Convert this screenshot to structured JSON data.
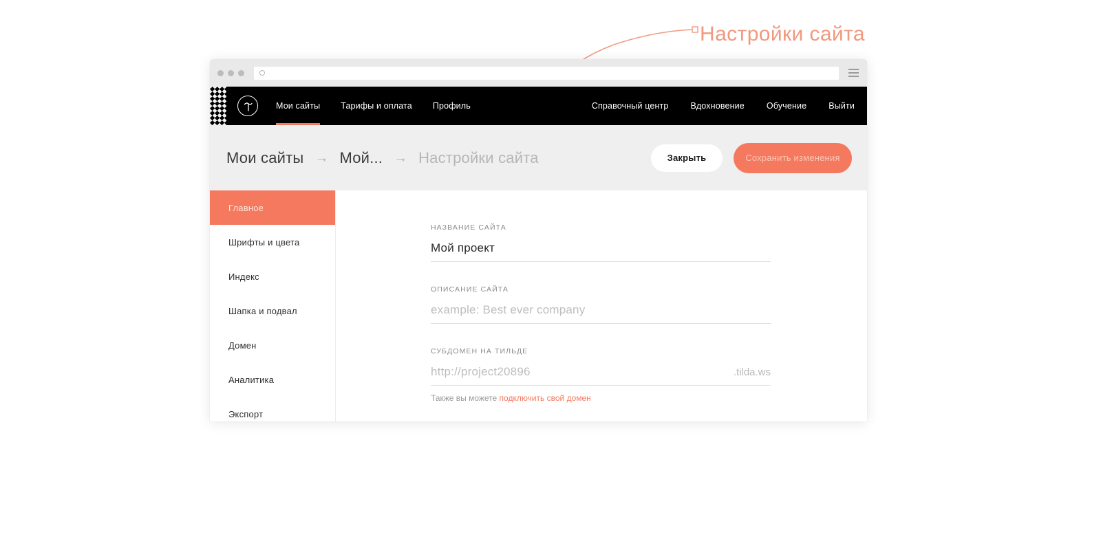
{
  "annotation": {
    "label": "Настройки сайта",
    "color": "#f0997f"
  },
  "browser": {
    "address_value": "",
    "address_placeholder": "",
    "menu_icon": "hamburger-icon"
  },
  "topnav": {
    "logo_icon": "tilda-logo-icon",
    "left_items": [
      {
        "label": "Мои сайты",
        "active": true
      },
      {
        "label": "Тарифы и оплата",
        "active": false
      },
      {
        "label": "Профиль",
        "active": false
      }
    ],
    "right_items": [
      {
        "label": "Справочный центр"
      },
      {
        "label": "Вдохновение"
      },
      {
        "label": "Обучение"
      },
      {
        "label": "Выйти"
      }
    ],
    "accent": "#f4795f"
  },
  "breadcrumb": {
    "items": [
      {
        "label": "Мои сайты",
        "muted": false
      },
      {
        "label": "Мой...",
        "muted": false
      },
      {
        "label": "Настройки сайта",
        "muted": true
      }
    ],
    "separator": "→"
  },
  "actions": {
    "close_label": "Закрыть",
    "save_label": "Сохранить изменения"
  },
  "sidebar": {
    "items": [
      {
        "label": "Главное",
        "active": true
      },
      {
        "label": "Шрифты и цвета",
        "active": false
      },
      {
        "label": "Индекс",
        "active": false
      },
      {
        "label": "Шапка и подвал",
        "active": false
      },
      {
        "label": "Домен",
        "active": false
      },
      {
        "label": "Аналитика",
        "active": false
      },
      {
        "label": "Экспорт",
        "active": false
      }
    ]
  },
  "form": {
    "site_title": {
      "label": "НАЗВАНИЕ САЙТА",
      "value": "Мой проект",
      "placeholder": ""
    },
    "site_description": {
      "label": "ОПИСАНИЕ САЙТА",
      "value": "",
      "placeholder": "example: Best ever company"
    },
    "subdomain": {
      "label": "СУБДОМЕН НА ТИЛЬДЕ",
      "value": "",
      "placeholder": "http://project20896",
      "suffix": ".tilda.ws",
      "hint_prefix": "Также вы можете ",
      "hint_link": "подключить свой домен"
    }
  }
}
